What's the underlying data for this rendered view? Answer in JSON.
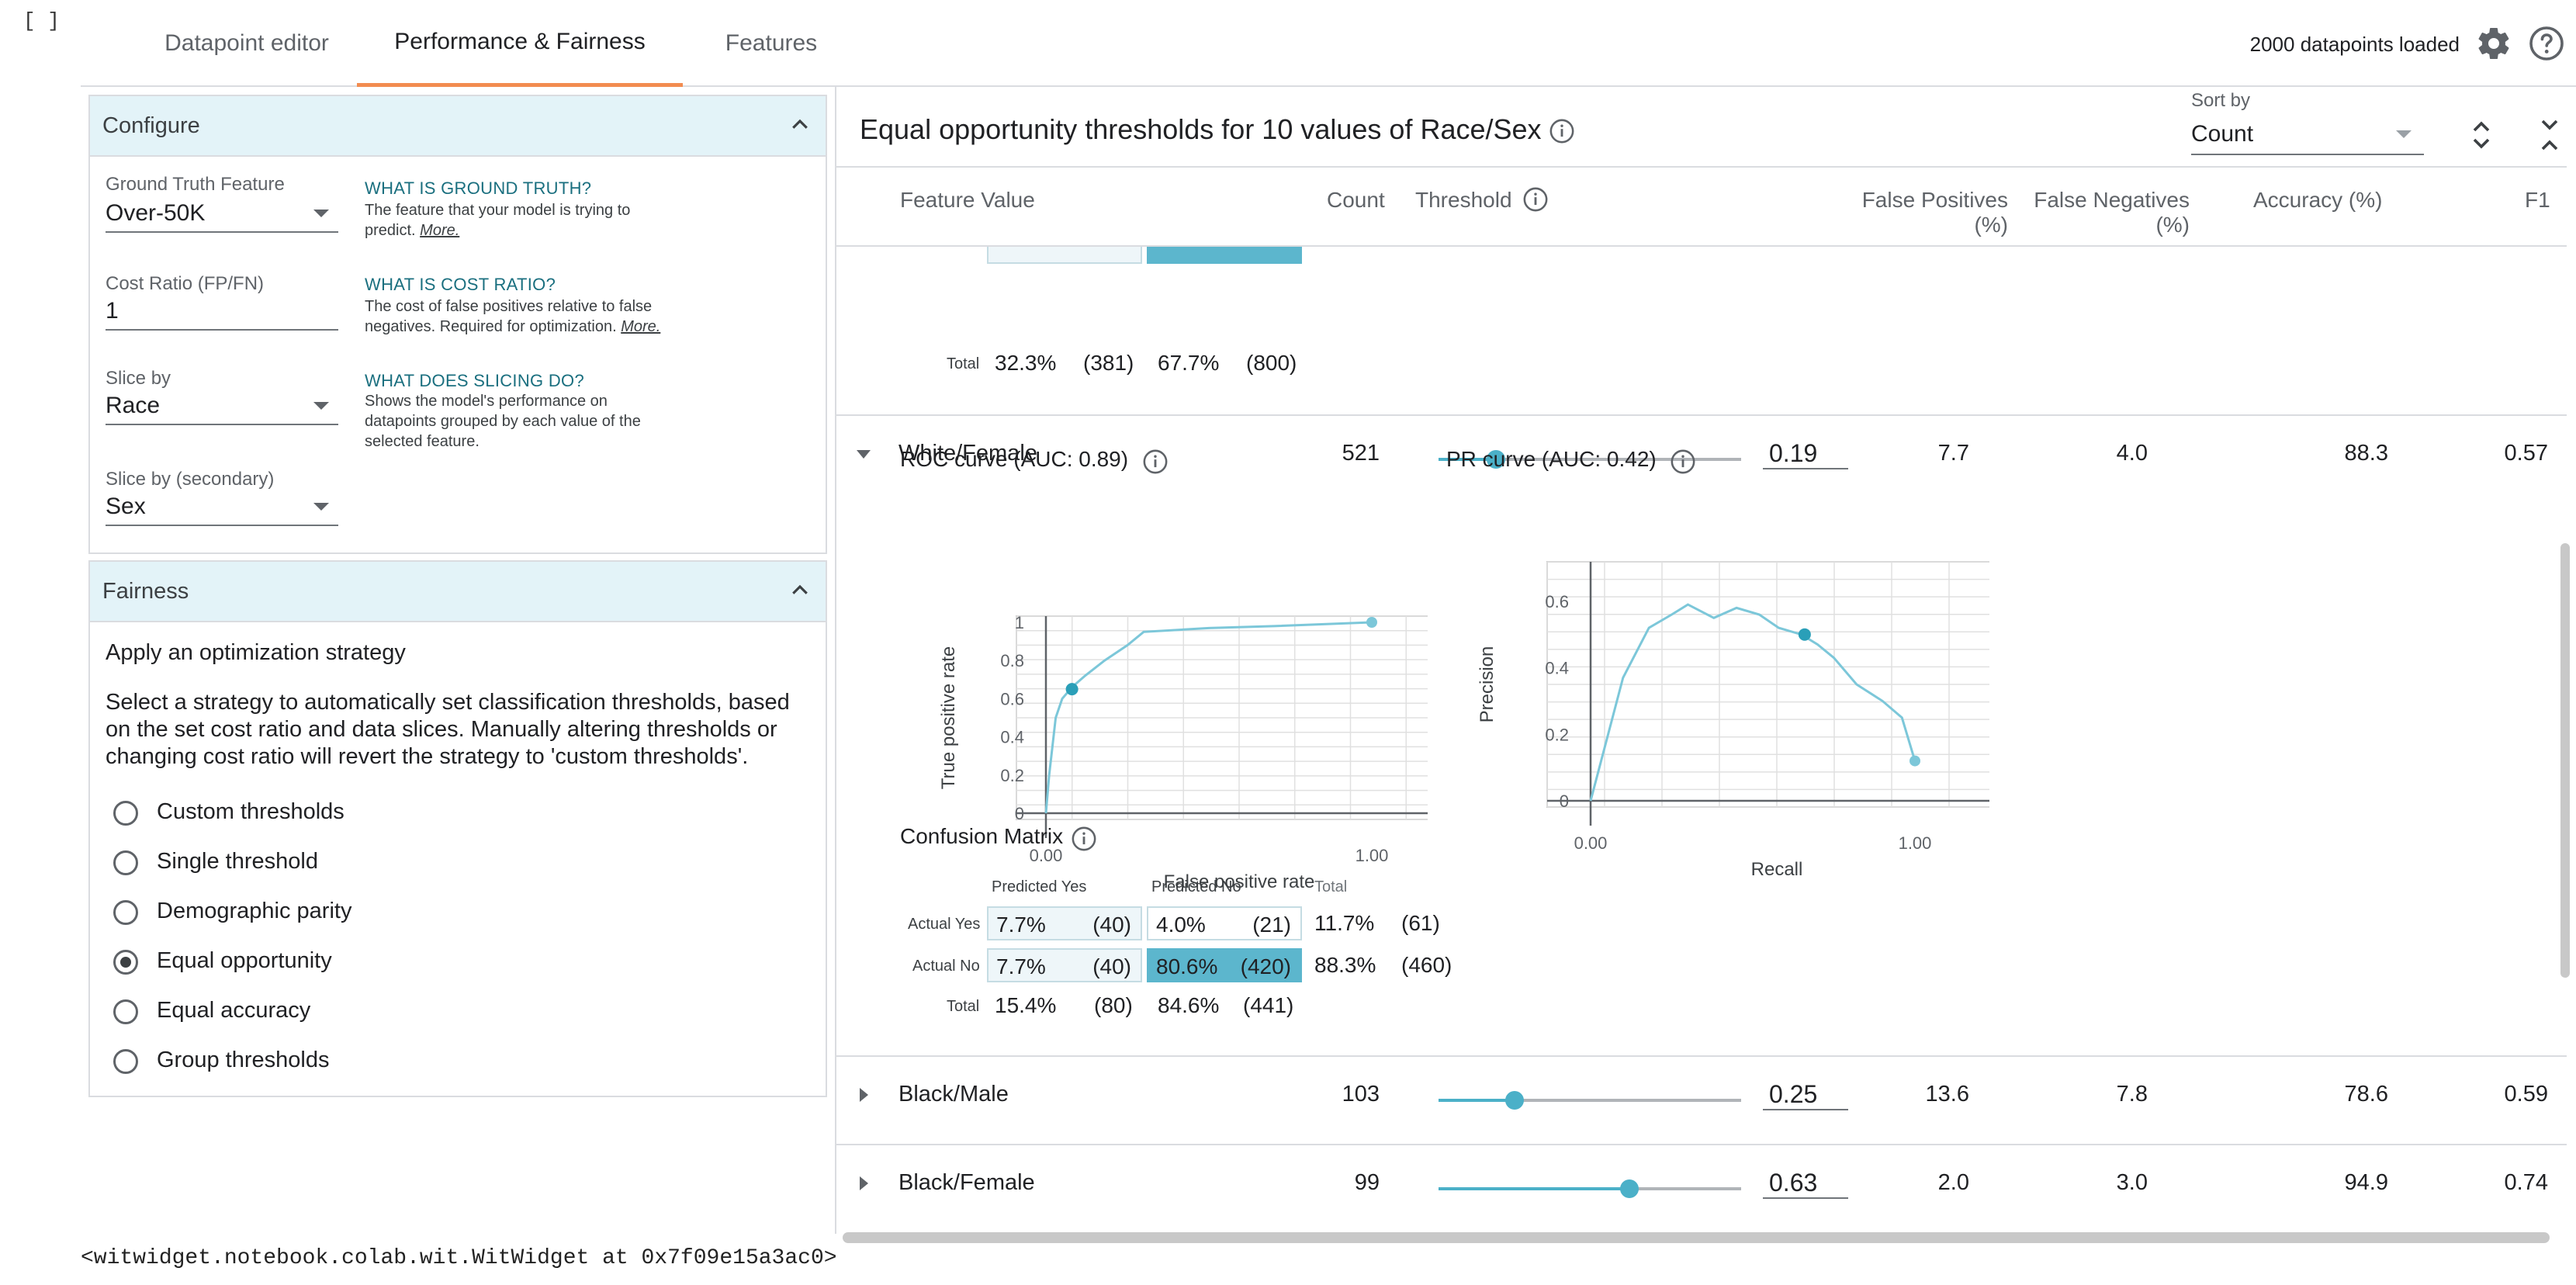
{
  "cell_marker": "[ ]",
  "nav": {
    "tabs": [
      "Datapoint editor",
      "Performance & Fairness",
      "Features"
    ],
    "status": "2000 datapoints loaded"
  },
  "configure": {
    "title": "Configure",
    "fields": [
      {
        "label": "Ground Truth Feature",
        "value": "Over-50K",
        "help_title": "WHAT IS GROUND TRUTH?",
        "help_text": "The feature that your model is trying to predict.",
        "help_link": "More."
      },
      {
        "label": "Cost Ratio (FP/FN)",
        "value": "1",
        "help_title": "WHAT IS COST RATIO?",
        "help_text": "The cost of false positives relative to false negatives. Required for optimization.",
        "help_link": "More."
      },
      {
        "label": "Slice by",
        "value": "Race",
        "help_title": "WHAT DOES SLICING DO?",
        "help_text": "Shows the model's performance on datapoints grouped by each value of the selected feature.",
        "help_link": ""
      },
      {
        "label": "Slice by (secondary)",
        "value": "Sex"
      }
    ]
  },
  "fairness": {
    "title": "Fairness",
    "heading": "Apply an optimization strategy",
    "description": "Select a strategy to automatically set classification thresholds, based on the set cost ratio and data slices. Manually altering thresholds or changing cost ratio will revert the strategy to 'custom thresholds'.",
    "options": [
      {
        "label": "Custom thresholds",
        "selected": false
      },
      {
        "label": "Single threshold",
        "selected": false
      },
      {
        "label": "Demographic parity",
        "selected": false
      },
      {
        "label": "Equal opportunity",
        "selected": true
      },
      {
        "label": "Equal accuracy",
        "selected": false
      },
      {
        "label": "Group thresholds",
        "selected": false
      }
    ]
  },
  "results": {
    "title": "Equal opportunity thresholds for 10 values of Race/Sex",
    "sort_label": "Sort by",
    "sort_value": "Count",
    "columns": {
      "feature_value": "Feature Value",
      "count": "Count",
      "threshold": "Threshold",
      "fp": [
        "False Positives",
        "(%)"
      ],
      "fn": [
        "False Negatives",
        "(%)"
      ],
      "accuracy": "Accuracy (%)",
      "f1": "F1"
    },
    "partial_total": {
      "label": "Total",
      "yes_pct": "32.3%",
      "yes_count": "(381)",
      "no_pct": "67.7%",
      "no_count": "(800)"
    },
    "rows": [
      {
        "name": "White/Female",
        "count": "521",
        "threshold": "0.19",
        "threshold_value": 0.19,
        "fp": "7.7",
        "fn": "4.0",
        "accuracy": "88.3",
        "f1": "0.57",
        "expanded": true
      },
      {
        "name": "Black/Male",
        "count": "103",
        "threshold": "0.25",
        "threshold_value": 0.25,
        "fp": "13.6",
        "fn": "7.8",
        "accuracy": "78.6",
        "f1": "0.59",
        "expanded": false
      },
      {
        "name": "Black/Female",
        "count": "99",
        "threshold": "0.63",
        "threshold_value": 0.63,
        "fp": "2.0",
        "fn": "3.0",
        "accuracy": "94.9",
        "f1": "0.74",
        "expanded": false
      }
    ],
    "roc": {
      "title": "ROC curve (AUC: 0.89)",
      "xlabel": "False positive rate",
      "ylabel": "True positive rate",
      "x_ticks": [
        "0.00",
        "1.00"
      ],
      "y_ticks": [
        "1",
        "0.8",
        "0.6",
        "0.4",
        "0.2",
        "0"
      ],
      "points": [
        [
          0,
          0
        ],
        [
          0.01,
          0.2
        ],
        [
          0.02,
          0.35
        ],
        [
          0.03,
          0.5
        ],
        [
          0.05,
          0.6
        ],
        [
          0.08,
          0.66
        ],
        [
          0.12,
          0.72
        ],
        [
          0.18,
          0.8
        ],
        [
          0.25,
          0.88
        ],
        [
          0.3,
          0.95
        ],
        [
          0.5,
          0.97
        ],
        [
          0.7,
          0.98
        ],
        [
          1.0,
          1.0
        ]
      ],
      "marker": [
        0.08,
        0.65
      ]
    },
    "pr": {
      "title": "PR curve (AUC: 0.42)",
      "xlabel": "Recall",
      "ylabel": "Precision",
      "x_ticks": [
        "0.00",
        "1.00"
      ],
      "y_ticks": [
        "0.6",
        "0.4",
        "0.2",
        "0"
      ],
      "points": [
        [
          0,
          0
        ],
        [
          0.1,
          0.37
        ],
        [
          0.18,
          0.52
        ],
        [
          0.25,
          0.56
        ],
        [
          0.3,
          0.59
        ],
        [
          0.38,
          0.55
        ],
        [
          0.45,
          0.58
        ],
        [
          0.52,
          0.56
        ],
        [
          0.58,
          0.52
        ],
        [
          0.65,
          0.5
        ],
        [
          0.7,
          0.47
        ],
        [
          0.75,
          0.43
        ],
        [
          0.82,
          0.35
        ],
        [
          0.9,
          0.3
        ],
        [
          0.96,
          0.25
        ],
        [
          1.0,
          0.12
        ]
      ],
      "marker": [
        0.66,
        0.5
      ]
    },
    "confusion": {
      "title": "Confusion Matrix",
      "col_heads": [
        "Predicted Yes",
        "Predicted No",
        "Total"
      ],
      "rows": [
        {
          "label": "Actual Yes",
          "yes_pct": "7.7%",
          "yes_count": "(40)",
          "no_pct": "4.0%",
          "no_count": "(21)",
          "tot_pct": "11.7%",
          "tot_count": "(61)"
        },
        {
          "label": "Actual No",
          "yes_pct": "7.7%",
          "yes_count": "(40)",
          "no_pct": "80.6%",
          "no_count": "(420)",
          "tot_pct": "88.3%",
          "tot_count": "(460)"
        },
        {
          "label": "Total",
          "yes_pct": "15.4%",
          "yes_count": "(80)",
          "no_pct": "84.6%",
          "no_count": "(441)"
        }
      ]
    }
  },
  "footer": "<witwidget.notebook.colab.wit.WitWidget at 0x7f09e15a3ac0>",
  "colors": {
    "accent": "#4bb0c8",
    "tab_active": "#f28c50",
    "header_bg": "#e3f3f8"
  }
}
